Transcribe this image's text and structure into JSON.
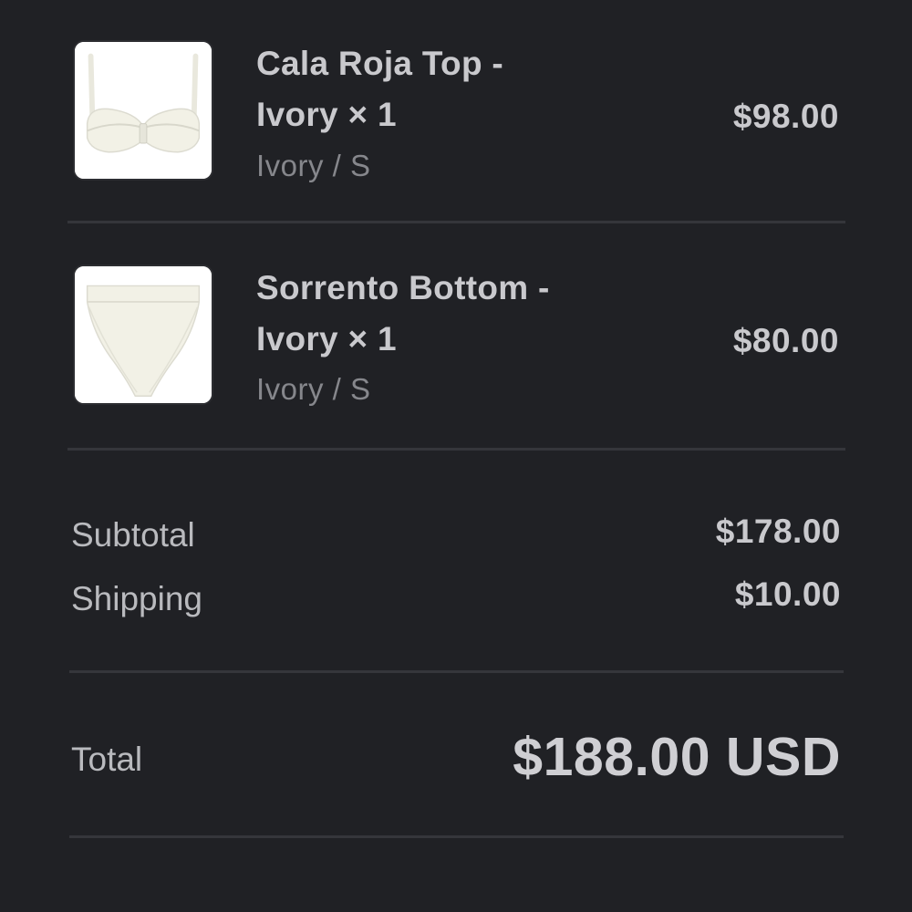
{
  "cart": {
    "items": [
      {
        "title_line1": "Cala Roja Top -",
        "title_line2": "Ivory × 1",
        "variant": "Ivory / S",
        "price": "$98.00",
        "thumbnail_icon": "bikini-top-image"
      },
      {
        "title_line1": "Sorrento Bottom -",
        "title_line2": "Ivory × 1",
        "variant": "Ivory / S",
        "price": "$80.00",
        "thumbnail_icon": "bikini-bottom-image"
      }
    ]
  },
  "summary": {
    "subtotal_label": "Subtotal",
    "subtotal_value": "$178.00",
    "shipping_label": "Shipping",
    "shipping_value": "$10.00",
    "total_label": "Total",
    "total_value": "$188.00 USD"
  },
  "colors": {
    "background": "#202125",
    "text_primary": "#c9c9cd",
    "text_secondary": "#86878c",
    "divider": "#35363b",
    "product_ivory": "#f2f1e6"
  }
}
